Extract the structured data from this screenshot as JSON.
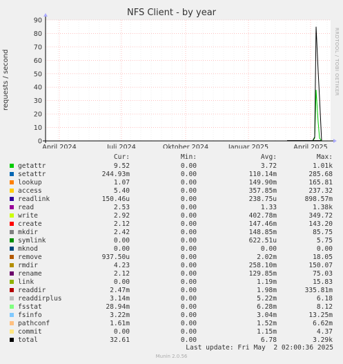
{
  "title": "NFS Client - by year",
  "ylabel": "requests / second",
  "side_text": "RRDTOOL / TOBI OETIKER",
  "headers": {
    "cur": "Cur:",
    "min": "Min:",
    "avg": "Avg:",
    "max": "Max:"
  },
  "last_update": "Last update: Fri May  2 02:00:36 2025",
  "munin_version": "Munin 2.0.56",
  "chart_data": {
    "type": "line",
    "title": "NFS Client - by year",
    "ylabel": "requests / second",
    "ylim": [
      0,
      90
    ],
    "y_ticks": [
      0,
      10,
      20,
      30,
      40,
      50,
      60,
      70,
      80,
      90
    ],
    "x_ticks": [
      "April 2024",
      "Juli 2024",
      "Oktober 2024",
      "Januar 2025",
      "April 2025"
    ],
    "grid": true,
    "series": [
      {
        "name": "getattr",
        "values": [
          0,
          0,
          2,
          38,
          14,
          2,
          0
        ]
      },
      {
        "name": "total",
        "values": [
          0,
          0,
          3,
          85,
          52,
          32,
          0
        ]
      }
    ]
  },
  "legend": [
    {
      "name": "getattr",
      "color": "#00cc00",
      "cur": "9.52",
      "min": "0.00",
      "avg": "3.72",
      "max": "1.01k"
    },
    {
      "name": "setattr",
      "color": "#0066b3",
      "cur": "244.93m",
      "min": "0.00",
      "avg": "110.14m",
      "max": "285.68"
    },
    {
      "name": "lookup",
      "color": "#ff8000",
      "cur": "1.07",
      "min": "0.00",
      "avg": "149.90m",
      "max": "165.81"
    },
    {
      "name": "access",
      "color": "#ffcc00",
      "cur": "5.40",
      "min": "0.00",
      "avg": "357.85m",
      "max": "237.32"
    },
    {
      "name": "readlink",
      "color": "#330099",
      "cur": "150.46u",
      "min": "0.00",
      "avg": "238.75u",
      "max": "898.57m"
    },
    {
      "name": "read",
      "color": "#990099",
      "cur": "2.53",
      "min": "0.00",
      "avg": "1.33",
      "max": "1.38k"
    },
    {
      "name": "write",
      "color": "#ccff00",
      "cur": "2.92",
      "min": "0.00",
      "avg": "402.78m",
      "max": "349.72"
    },
    {
      "name": "create",
      "color": "#ff0000",
      "cur": "2.12",
      "min": "0.00",
      "avg": "147.46m",
      "max": "143.20"
    },
    {
      "name": "mkdir",
      "color": "#808080",
      "cur": "2.42",
      "min": "0.00",
      "avg": "148.85m",
      "max": "85.75"
    },
    {
      "name": "symlink",
      "color": "#008f00",
      "cur": "0.00",
      "min": "0.00",
      "avg": "622.51u",
      "max": "5.75"
    },
    {
      "name": "mknod",
      "color": "#00487d",
      "cur": "0.00",
      "min": "0.00",
      "avg": "0.00",
      "max": "0.00"
    },
    {
      "name": "remove",
      "color": "#b35a00",
      "cur": "937.50u",
      "min": "0.00",
      "avg": "2.02m",
      "max": "18.05"
    },
    {
      "name": "rmdir",
      "color": "#b38f00",
      "cur": "4.23",
      "min": "0.00",
      "avg": "258.10m",
      "max": "150.07"
    },
    {
      "name": "rename",
      "color": "#6b006b",
      "cur": "2.12",
      "min": "0.00",
      "avg": "129.85m",
      "max": "75.03"
    },
    {
      "name": "link",
      "color": "#8fb300",
      "cur": "0.00",
      "min": "0.00",
      "avg": "1.19m",
      "max": "15.83"
    },
    {
      "name": "readdir",
      "color": "#b30000",
      "cur": "2.47m",
      "min": "0.00",
      "avg": "1.98m",
      "max": "335.81m"
    },
    {
      "name": "readdirplus",
      "color": "#bebebe",
      "cur": "3.14m",
      "min": "0.00",
      "avg": "5.22m",
      "max": "6.18"
    },
    {
      "name": "fsstat",
      "color": "#80ff80",
      "cur": "28.94m",
      "min": "0.00",
      "avg": "6.28m",
      "max": "8.12"
    },
    {
      "name": "fsinfo",
      "color": "#80c9ff",
      "cur": "3.22m",
      "min": "0.00",
      "avg": "3.04m",
      "max": "13.25m"
    },
    {
      "name": "pathconf",
      "color": "#ffc080",
      "cur": "1.61m",
      "min": "0.00",
      "avg": "1.52m",
      "max": "6.62m"
    },
    {
      "name": "commit",
      "color": "#ffe680",
      "cur": "0.00",
      "min": "0.00",
      "avg": "1.15m",
      "max": "4.37"
    },
    {
      "name": "total",
      "color": "#000000",
      "cur": "32.61",
      "min": "0.00",
      "avg": "6.78",
      "max": "3.29k"
    }
  ]
}
